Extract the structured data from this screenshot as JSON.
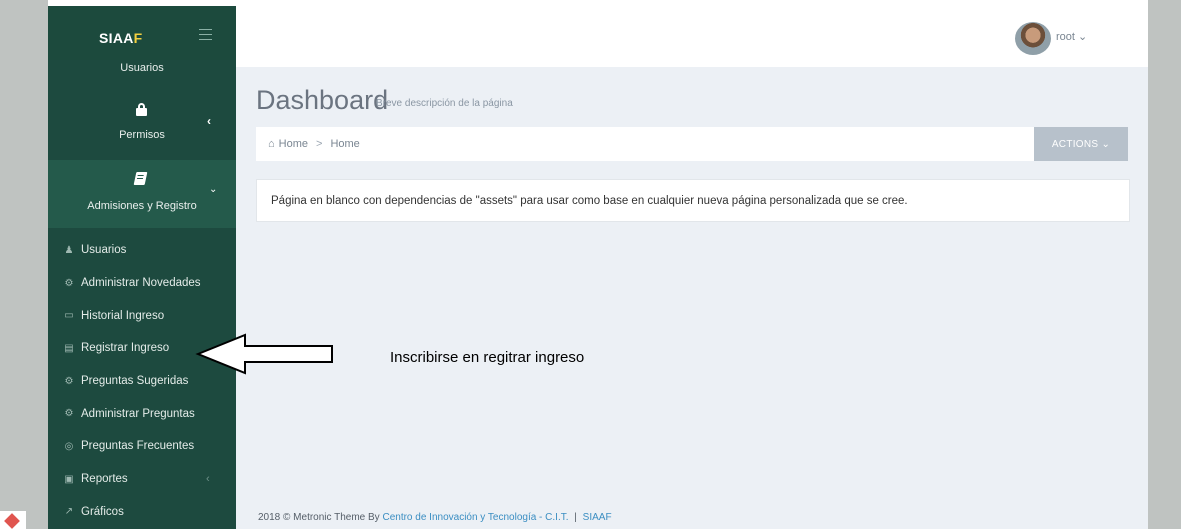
{
  "brand": {
    "prefix": "SIAA",
    "accent": "F"
  },
  "sidebar": {
    "top_item": "Usuarios",
    "permisos": "Permisos",
    "admisiones": "Admisiones y Registro",
    "submenu": [
      {
        "label": "Usuarios",
        "icon": "user-icon"
      },
      {
        "label": "Administrar Novedades",
        "icon": "gears-icon"
      },
      {
        "label": "Historial Ingreso",
        "icon": "monitor-icon"
      },
      {
        "label": "Registrar Ingreso",
        "icon": "id-card-icon"
      },
      {
        "label": "Preguntas Sugeridas",
        "icon": "gears-icon"
      },
      {
        "label": "Administrar Preguntas",
        "icon": "gears-icon"
      },
      {
        "label": "Preguntas Frecuentes",
        "icon": "help-ring-icon"
      },
      {
        "label": "Reportes",
        "icon": "document-icon"
      },
      {
        "label": "Gráficos",
        "icon": "line-chart-icon"
      }
    ]
  },
  "header": {
    "user": "root"
  },
  "page": {
    "title": "Dashboard",
    "subtitle": "Breve descripción de la página"
  },
  "breadcrumb": {
    "home": "Home",
    "current": "Home",
    "actions": "ACTIONS"
  },
  "note": "Página en blanco con dependencias de \"assets\" para usar como base en cualquier nueva página personalizada que se cree.",
  "annotation": "Inscribirse en regitrar ingreso",
  "footer": {
    "prefix": "2018 © Metronic Theme By",
    "link": "Centro de Innovación y Tecnología - C.I.T.",
    "sep": "|",
    "app": "SIAAF"
  },
  "colors": {
    "sidebar": "#1d4a3f",
    "active": "#245a4b",
    "background": "#ecf0f5",
    "link": "#3b8ec2"
  }
}
